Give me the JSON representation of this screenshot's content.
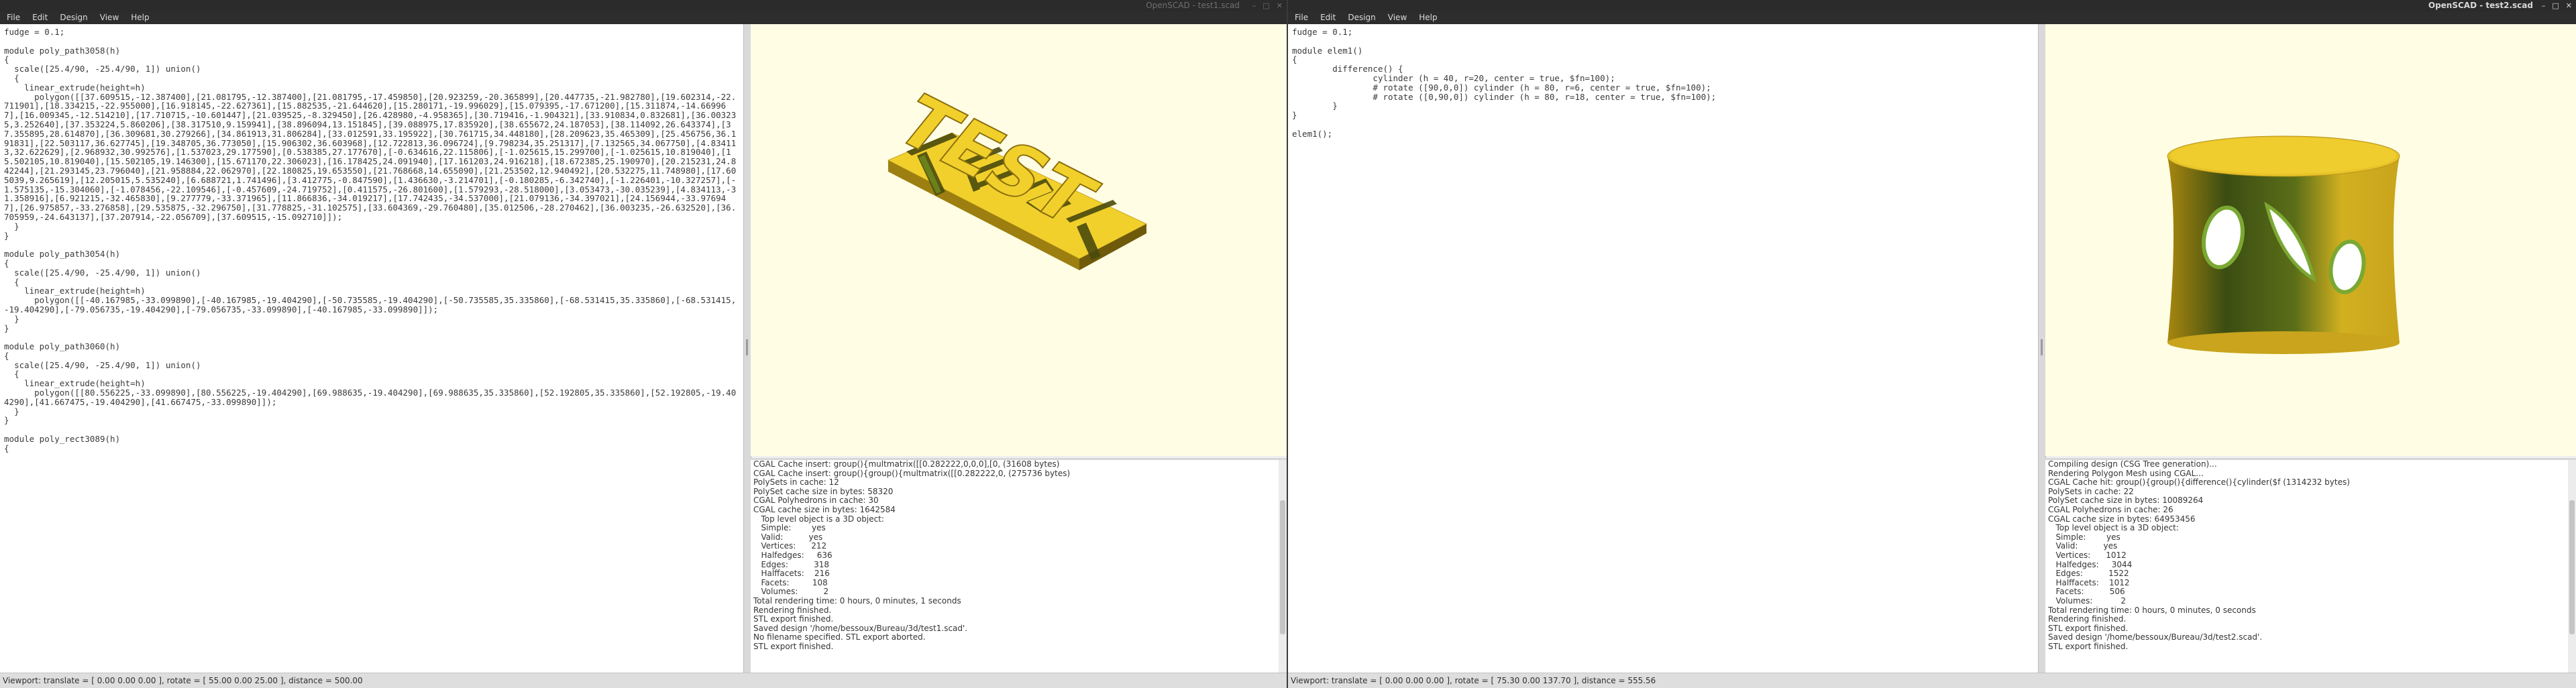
{
  "window1": {
    "title": "OpenSCAD - test1.scad",
    "menu": [
      "File",
      "Edit",
      "Design",
      "View",
      "Help"
    ],
    "editor_code": "fudge = 0.1;\n\nmodule poly_path3058(h)\n{\n  scale([25.4/90, -25.4/90, 1]) union()\n  {\n    linear_extrude(height=h)\n      polygon([[37.609515,-12.387400],[21.081795,-12.387400],[21.081795,-17.459850],[20.923259,-20.365899],[20.447735,-21.982780],[19.602314,-22.711901],[18.334215,-22.955000],[16.918145,-22.627361],[15.882535,-21.644620],[15.280171,-19.996029],[15.079395,-17.671200],[15.311874,-14.669967],[16.009345,-12.514210],[17.710715,-10.601447],[21.039525,-8.329450],[26.428980,-4.958365],[30.719416,-1.904321],[33.910834,0.832681],[36.003235,3.252640],[37.353224,5.860206],[38.317510,9.159941],[38.896094,13.151845],[39.088975,17.835920],[38.655672,24.187053],[38.114092,26.643374],[37.355895,28.614870],[36.309681,30.279266],[34.861913,31.806284],[33.012591,33.195922],[30.761715,34.448180],[28.209623,35.465309],[25.456756,36.191831],[22.503117,36.627745],[19.348705,36.773050],[15.906302,36.603968],[12.722813,36.096724],[9.798234,35.251317],[7.132565,34.067750],[4.834113,32.622629],[2.968932,30.992576],[1.537023,29.177590],[0.538385,27.177670],[-0.634616,22.115806],[-1.025615,15.299700],[-1.025615,10.819040],[15.502105,10.819040],[15.502105,19.146300],[15.671170,22.306023],[16.178425,24.091940],[17.161203,24.916218],[18.672385,25.190970],[20.215231,24.842244],[21.293145,23.796040],[21.958884,22.062970],[22.180825,19.653550],[21.768668,14.655090],[21.253502,12.940492],[20.532275,11.748980],[17.605039,9.265619],[12.205015,5.535240],[6.688721,1.741496],[3.412775,-0.847590],[1.436630,-3.214701],[-0.180285,-6.342740],[-1.226401,-10.327257],[-1.575135,-15.304060],[-1.078456,-22.109546],[-0.457609,-24.719752],[0.411575,-26.801600],[1.579293,-28.518000],[3.053473,-30.035239],[4.834113,-31.358916],[6.921215,-32.465830],[9.277779,-33.371965],[11.866836,-34.019217],[17.742435,-34.537000],[21.079136,-34.397021],[24.156944,-33.976947],[26.975857,-33.276858],[29.535875,-32.296750],[31.778825,-31.102575],[33.604369,-29.760480],[35.012506,-28.270462],[36.003235,-26.632520],[36.705959,-24.643137],[37.207914,-22.056709],[37.609515,-15.092710]]);\n  }\n}\n\nmodule poly_path3054(h)\n{\n  scale([25.4/90, -25.4/90, 1]) union()\n  {\n    linear_extrude(height=h)\n      polygon([[-40.167985,-33.099890],[-40.167985,-19.404290],[-50.735585,-19.404290],[-50.735585,35.335860],[-68.531415,35.335860],[-68.531415,-19.404290],[-79.056735,-19.404290],[-79.056735,-33.099890],[-40.167985,-33.099890]]);\n  }\n}\n\nmodule poly_path3060(h)\n{\n  scale([25.4/90, -25.4/90, 1]) union()\n  {\n    linear_extrude(height=h)\n      polygon([[80.556225,-33.099890],[80.556225,-19.404290],[69.988635,-19.404290],[69.988635,35.335860],[52.192805,35.335860],[52.192805,-19.404290],[41.667475,-19.404290],[41.667475,-33.099890]]);\n  }\n}\n\nmodule poly_rect3089(h)\n{",
    "console_lines": [
      "CGAL Cache insert: group(){multmatrix([[0.282222,0,0,0],[0, (31608 bytes)",
      "CGAL Cache insert: group(){group(){multmatrix([[0.282222,0, (275736 bytes)",
      "PolySets in cache: 12",
      "PolySet cache size in bytes: 58320",
      "CGAL Polyhedrons in cache: 30",
      "CGAL cache size in bytes: 1642584",
      "   Top level object is a 3D object:",
      "   Simple:        yes",
      "   Valid:          yes",
      "   Vertices:      212",
      "   Halfedges:     636",
      "   Edges:          318",
      "   Halffacets:    216",
      "   Facets:         108",
      "   Volumes:          2",
      "Total rendering time: 0 hours, 0 minutes, 1 seconds",
      "Rendering finished.",
      "STL export finished.",
      "Saved design '/home/bessoux/Bureau/3d/test1.scad'.",
      "No filename specified. STL export aborted.",
      "STL export finished."
    ],
    "status": "Viewport: translate = [ 0.00 0.00 0.00 ], rotate = [ 55.00 0.00 25.00 ], distance = 500.00",
    "model_text": "TEST"
  },
  "window2": {
    "title": "OpenSCAD - test2.scad",
    "menu": [
      "File",
      "Edit",
      "Design",
      "View",
      "Help"
    ],
    "editor_code": "fudge = 0.1;\n\nmodule elem1()\n{\n        difference() {\n                cylinder (h = 40, r=20, center = true, $fn=100);\n                # rotate ([90,0,0]) cylinder (h = 80, r=6, center = true, $fn=100);\n                # rotate ([0,90,0]) cylinder (h = 80, r=18, center = true, $fn=100);\n        }\n}\n\nelem1();",
    "console_lines": [
      "Compiling design (CSG Tree generation)...",
      "Rendering Polygon Mesh using CGAL...",
      "CGAL Cache hit: group(){group(){difference(){cylinder($f (1314232 bytes)",
      "PolySets in cache: 22",
      "PolySet cache size in bytes: 10089264",
      "CGAL Polyhedrons in cache: 26",
      "CGAL cache size in bytes: 64953456",
      "   Top level object is a 3D object:",
      "   Simple:        yes",
      "   Valid:          yes",
      "   Vertices:      1012",
      "   Halfedges:     3044",
      "   Edges:          1522",
      "   Halffacets:    1012",
      "   Facets:          506",
      "   Volumes:           2",
      "Total rendering time: 0 hours, 0 minutes, 0 seconds",
      "Rendering finished.",
      "STL export finished.",
      "Saved design '/home/bessoux/Bureau/3d/test2.scad'.",
      "STL export finished."
    ],
    "status": "Viewport: translate = [ 0.00 0.00 0.00 ], rotate = [ 75.30 0.00 137.70 ], distance = 555.56"
  },
  "window_buttons": [
    "–",
    "□",
    "✕"
  ],
  "colors": {
    "viewport_bg": "#fffee5",
    "model_yellow": "#f2d02c",
    "model_dark": "#3b4d12",
    "model_green": "#7aa832"
  }
}
